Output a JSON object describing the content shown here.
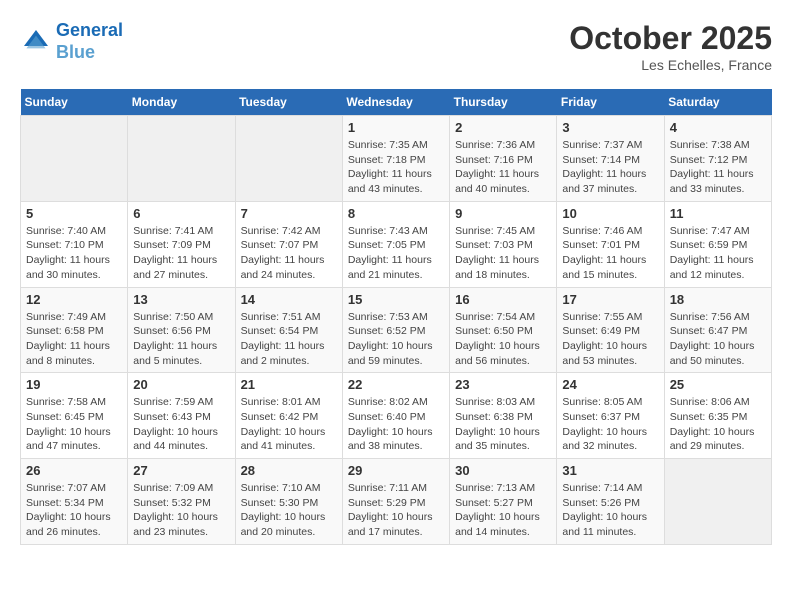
{
  "header": {
    "logo_line1": "General",
    "logo_line2": "Blue",
    "month": "October 2025",
    "location": "Les Echelles, France"
  },
  "weekdays": [
    "Sunday",
    "Monday",
    "Tuesday",
    "Wednesday",
    "Thursday",
    "Friday",
    "Saturday"
  ],
  "weeks": [
    [
      {
        "day": "",
        "info": ""
      },
      {
        "day": "",
        "info": ""
      },
      {
        "day": "",
        "info": ""
      },
      {
        "day": "1",
        "info": "Sunrise: 7:35 AM\nSunset: 7:18 PM\nDaylight: 11 hours and 43 minutes."
      },
      {
        "day": "2",
        "info": "Sunrise: 7:36 AM\nSunset: 7:16 PM\nDaylight: 11 hours and 40 minutes."
      },
      {
        "day": "3",
        "info": "Sunrise: 7:37 AM\nSunset: 7:14 PM\nDaylight: 11 hours and 37 minutes."
      },
      {
        "day": "4",
        "info": "Sunrise: 7:38 AM\nSunset: 7:12 PM\nDaylight: 11 hours and 33 minutes."
      }
    ],
    [
      {
        "day": "5",
        "info": "Sunrise: 7:40 AM\nSunset: 7:10 PM\nDaylight: 11 hours and 30 minutes."
      },
      {
        "day": "6",
        "info": "Sunrise: 7:41 AM\nSunset: 7:09 PM\nDaylight: 11 hours and 27 minutes."
      },
      {
        "day": "7",
        "info": "Sunrise: 7:42 AM\nSunset: 7:07 PM\nDaylight: 11 hours and 24 minutes."
      },
      {
        "day": "8",
        "info": "Sunrise: 7:43 AM\nSunset: 7:05 PM\nDaylight: 11 hours and 21 minutes."
      },
      {
        "day": "9",
        "info": "Sunrise: 7:45 AM\nSunset: 7:03 PM\nDaylight: 11 hours and 18 minutes."
      },
      {
        "day": "10",
        "info": "Sunrise: 7:46 AM\nSunset: 7:01 PM\nDaylight: 11 hours and 15 minutes."
      },
      {
        "day": "11",
        "info": "Sunrise: 7:47 AM\nSunset: 6:59 PM\nDaylight: 11 hours and 12 minutes."
      }
    ],
    [
      {
        "day": "12",
        "info": "Sunrise: 7:49 AM\nSunset: 6:58 PM\nDaylight: 11 hours and 8 minutes."
      },
      {
        "day": "13",
        "info": "Sunrise: 7:50 AM\nSunset: 6:56 PM\nDaylight: 11 hours and 5 minutes."
      },
      {
        "day": "14",
        "info": "Sunrise: 7:51 AM\nSunset: 6:54 PM\nDaylight: 11 hours and 2 minutes."
      },
      {
        "day": "15",
        "info": "Sunrise: 7:53 AM\nSunset: 6:52 PM\nDaylight: 10 hours and 59 minutes."
      },
      {
        "day": "16",
        "info": "Sunrise: 7:54 AM\nSunset: 6:50 PM\nDaylight: 10 hours and 56 minutes."
      },
      {
        "day": "17",
        "info": "Sunrise: 7:55 AM\nSunset: 6:49 PM\nDaylight: 10 hours and 53 minutes."
      },
      {
        "day": "18",
        "info": "Sunrise: 7:56 AM\nSunset: 6:47 PM\nDaylight: 10 hours and 50 minutes."
      }
    ],
    [
      {
        "day": "19",
        "info": "Sunrise: 7:58 AM\nSunset: 6:45 PM\nDaylight: 10 hours and 47 minutes."
      },
      {
        "day": "20",
        "info": "Sunrise: 7:59 AM\nSunset: 6:43 PM\nDaylight: 10 hours and 44 minutes."
      },
      {
        "day": "21",
        "info": "Sunrise: 8:01 AM\nSunset: 6:42 PM\nDaylight: 10 hours and 41 minutes."
      },
      {
        "day": "22",
        "info": "Sunrise: 8:02 AM\nSunset: 6:40 PM\nDaylight: 10 hours and 38 minutes."
      },
      {
        "day": "23",
        "info": "Sunrise: 8:03 AM\nSunset: 6:38 PM\nDaylight: 10 hours and 35 minutes."
      },
      {
        "day": "24",
        "info": "Sunrise: 8:05 AM\nSunset: 6:37 PM\nDaylight: 10 hours and 32 minutes."
      },
      {
        "day": "25",
        "info": "Sunrise: 8:06 AM\nSunset: 6:35 PM\nDaylight: 10 hours and 29 minutes."
      }
    ],
    [
      {
        "day": "26",
        "info": "Sunrise: 7:07 AM\nSunset: 5:34 PM\nDaylight: 10 hours and 26 minutes."
      },
      {
        "day": "27",
        "info": "Sunrise: 7:09 AM\nSunset: 5:32 PM\nDaylight: 10 hours and 23 minutes."
      },
      {
        "day": "28",
        "info": "Sunrise: 7:10 AM\nSunset: 5:30 PM\nDaylight: 10 hours and 20 minutes."
      },
      {
        "day": "29",
        "info": "Sunrise: 7:11 AM\nSunset: 5:29 PM\nDaylight: 10 hours and 17 minutes."
      },
      {
        "day": "30",
        "info": "Sunrise: 7:13 AM\nSunset: 5:27 PM\nDaylight: 10 hours and 14 minutes."
      },
      {
        "day": "31",
        "info": "Sunrise: 7:14 AM\nSunset: 5:26 PM\nDaylight: 10 hours and 11 minutes."
      },
      {
        "day": "",
        "info": ""
      }
    ]
  ]
}
